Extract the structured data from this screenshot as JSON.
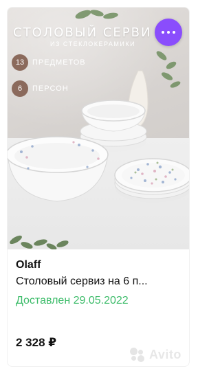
{
  "card": {
    "photo": {
      "title": "СТОЛОВЫЙ СЕРВИ",
      "subtitle": "ИЗ СТЕКЛОКЕРАМИКИ",
      "badges": [
        {
          "number": "13",
          "label": "ПРЕДМЕТОВ"
        },
        {
          "number": "6",
          "label": "ПЕРСОН"
        }
      ]
    },
    "more_button_icon": "more-dots-icon",
    "brand": "Olaff",
    "title": "Столовый сервиз на 6 п...",
    "delivery": "Доставлен 29.05.2022",
    "price": "2 328 ₽",
    "watermark": "Avito"
  },
  "colors": {
    "accent_purple": "#8a4dfc",
    "delivery_green": "#3dbc6a",
    "badge_brown": "#8b6a5c"
  }
}
